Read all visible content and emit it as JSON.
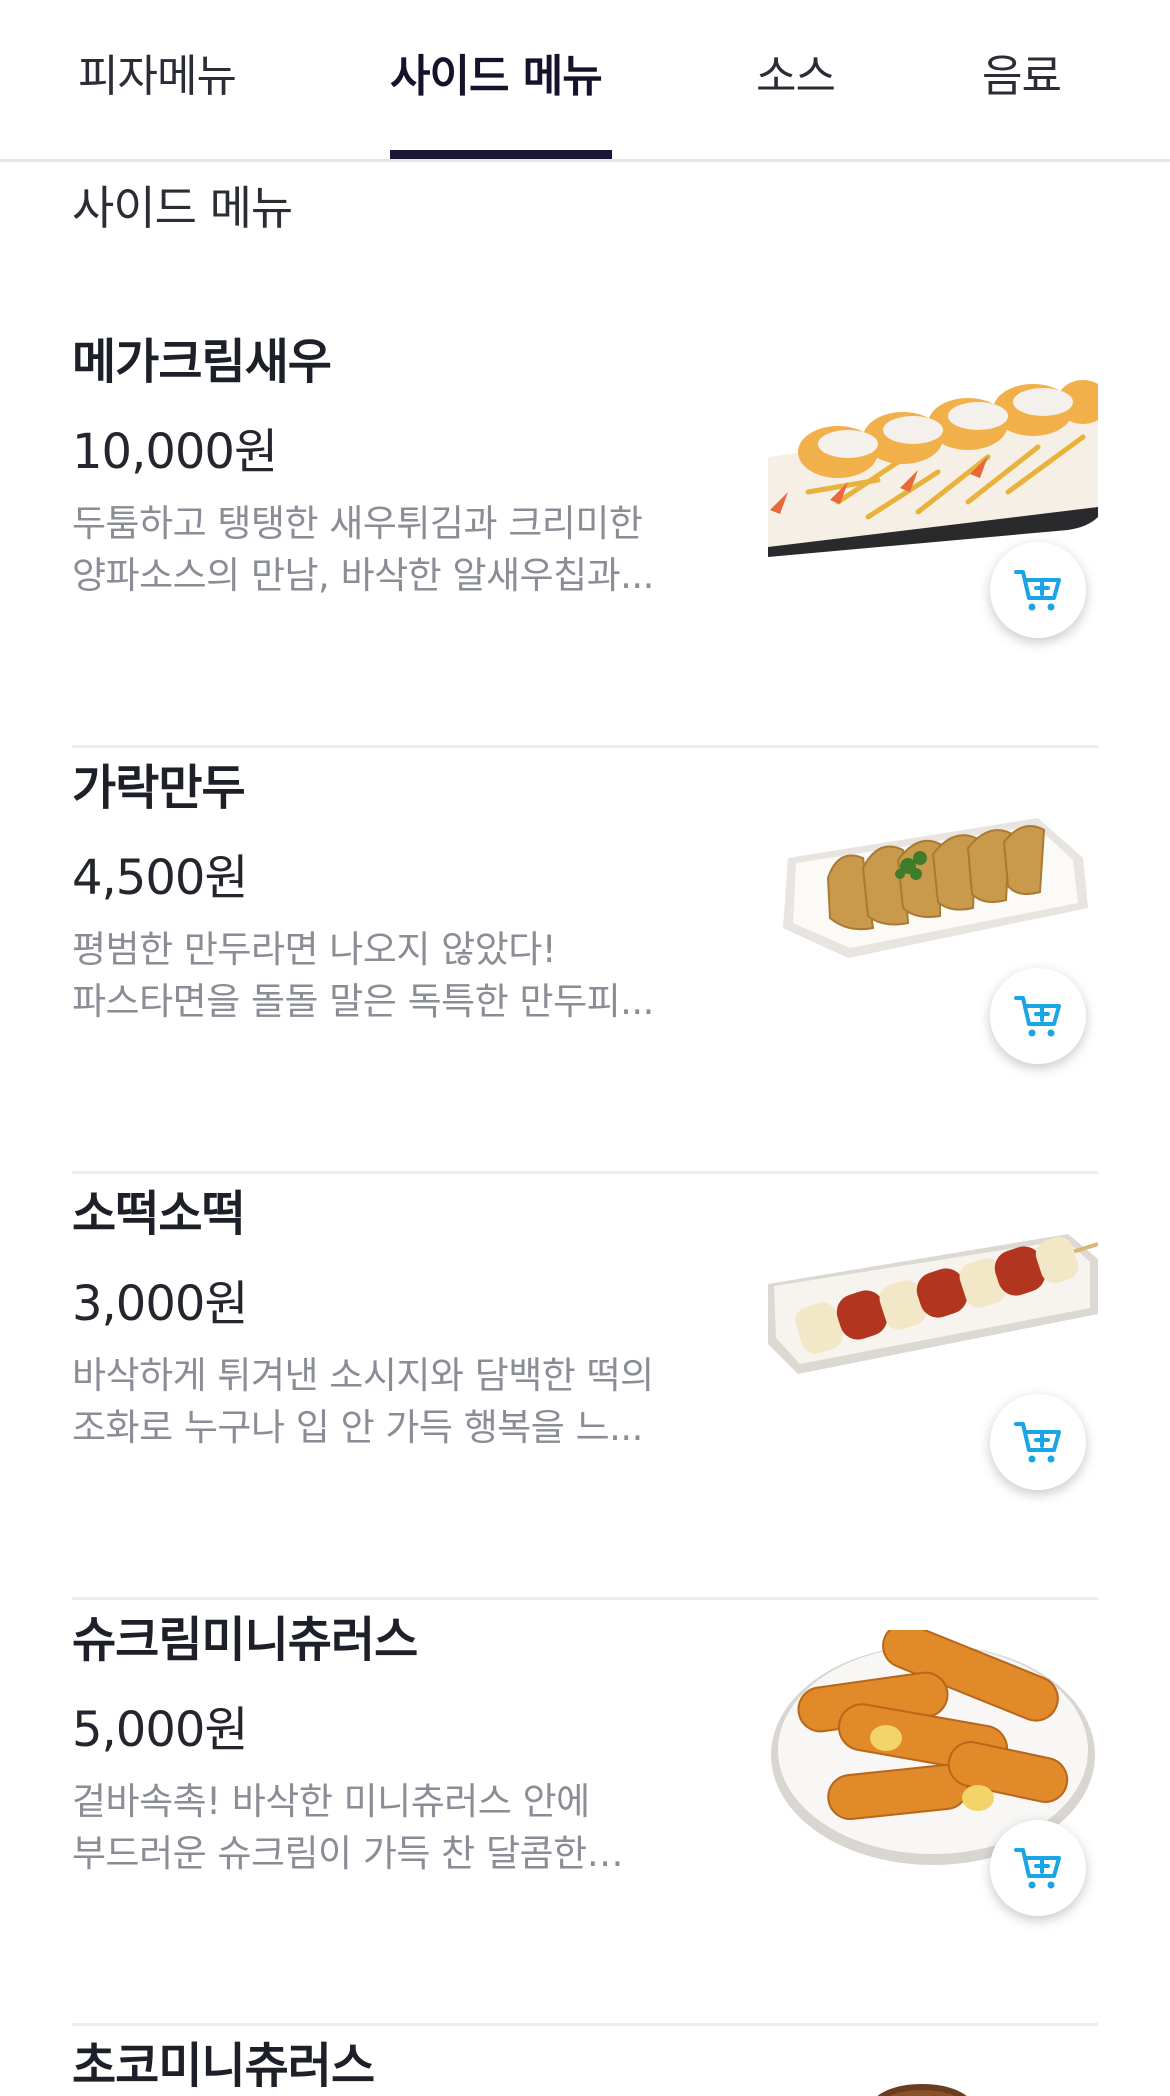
{
  "tabs": [
    {
      "label": "피자메뉴",
      "active": false
    },
    {
      "label": "사이드 메뉴",
      "active": true
    },
    {
      "label": "소스",
      "active": false
    },
    {
      "label": "음료",
      "active": false
    }
  ],
  "section_title": "사이드 메뉴",
  "items": [
    {
      "name": "메가크림새우",
      "price": "10,000원",
      "desc_line1": "두툼하고 탱탱한 새우튀김과 크리미한",
      "desc_line2": "양파소스의 만남, 바삭한 알새우칩과...",
      "image_icon": "fried-shrimp-platter"
    },
    {
      "name": "가락만두",
      "price": "4,500원",
      "desc_line1": "평범한 만두라면 나오지 않았다!",
      "desc_line2": "파스타면을 돌돌 말은 독특한 만두피...",
      "image_icon": "dumpling-plate"
    },
    {
      "name": "소떡소떡",
      "price": "3,000원",
      "desc_line1": "바삭하게 튀겨낸 소시지와 담백한 떡의",
      "desc_line2": "조화로 누구나 입 안 가득 행복을 느...",
      "image_icon": "sausage-rice-cake-skewer"
    },
    {
      "name": "슈크림미니츄러스",
      "price": "5,000원",
      "desc_line1": "겉바속촉! 바삭한 미니츄러스 안에",
      "desc_line2": "부드러운 슈크림이 가득 찬 달콤한…",
      "image_icon": "mini-churros-plate"
    },
    {
      "name": "초코미니츄러스",
      "price": "",
      "desc_line1": "",
      "desc_line2": "",
      "image_icon": "choco-churros"
    }
  ],
  "colors": {
    "accent_underline": "#1a1636",
    "cart_icon": "#1aa6e6",
    "description": "#8b8d96"
  }
}
